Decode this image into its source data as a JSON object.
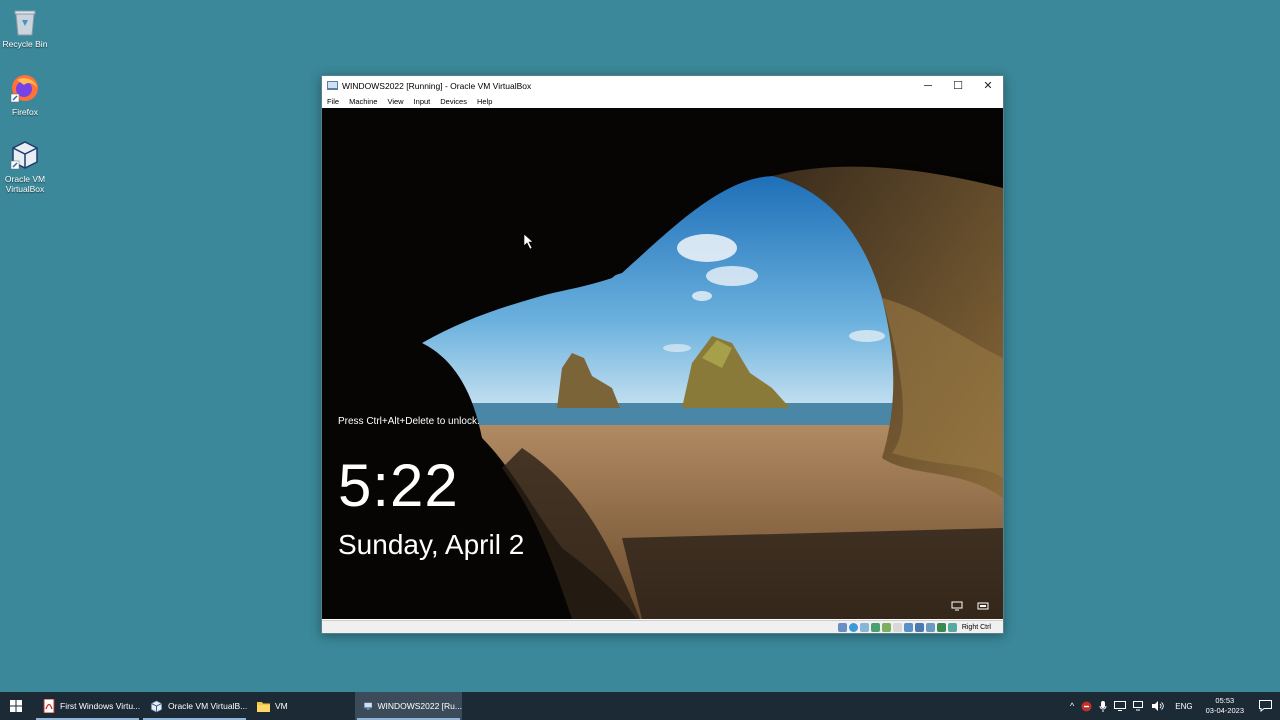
{
  "desktop": {
    "icons": [
      {
        "label": "Recycle Bin",
        "icon": "recycle-bin-icon"
      },
      {
        "label": "Firefox",
        "icon": "firefox-icon"
      },
      {
        "label": "Oracle VM\nVirtualBox",
        "icon": "virtualbox-icon"
      }
    ],
    "background_color": "#3a8899"
  },
  "window": {
    "title": "WINDOWS2022 [Running] - Oracle VM VirtualBox",
    "menu": [
      "File",
      "Machine",
      "View",
      "Input",
      "Devices",
      "Help"
    ],
    "controls": {
      "minimize": "─",
      "maximize": "☐",
      "close": "✕"
    },
    "status": {
      "host_key": "Right Ctrl"
    }
  },
  "lockscreen": {
    "hint": "Press Ctrl+Alt+Delete to unlock.",
    "time": "5:22",
    "date": "Sunday, April 2"
  },
  "taskbar": {
    "buttons": [
      {
        "label": "First Windows Virtu...",
        "icon": "pdf-icon",
        "active": false
      },
      {
        "label": "Oracle VM VirtualB...",
        "icon": "virtualbox-icon",
        "active": false
      },
      {
        "label": "VM",
        "icon": "folder-icon",
        "active": false
      },
      {
        "label": "WINDOWS2022 [Ru...",
        "icon": "vm-window-icon",
        "active": true
      }
    ],
    "tray": {
      "language": "ENG",
      "time": "05:53",
      "date": "03-04-2023"
    },
    "background_color": "#1c2a36"
  }
}
